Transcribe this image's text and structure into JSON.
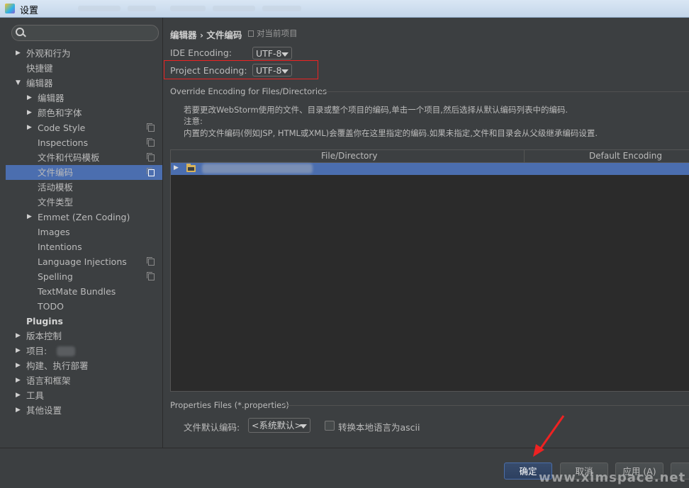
{
  "window": {
    "title": "设置"
  },
  "search": {
    "placeholder": ""
  },
  "sidebar": {
    "items": [
      {
        "label": "外观和行为",
        "arrow": "▶"
      },
      {
        "label": "快捷键"
      },
      {
        "label": "编辑器",
        "arrow": "▼"
      },
      {
        "label": "编辑器",
        "arrow": "▶"
      },
      {
        "label": "颜色和字体",
        "arrow": "▶"
      },
      {
        "label": "Code Style",
        "arrow": "▶"
      },
      {
        "label": "Inspections"
      },
      {
        "label": "文件和代码模板"
      },
      {
        "label": "文件编码"
      },
      {
        "label": "活动模板"
      },
      {
        "label": "文件类型"
      },
      {
        "label": "Emmet (Zen Coding)",
        "arrow": "▶"
      },
      {
        "label": "Images"
      },
      {
        "label": "Intentions"
      },
      {
        "label": "Language Injections"
      },
      {
        "label": "Spelling"
      },
      {
        "label": "TextMate Bundles"
      },
      {
        "label": "TODO"
      },
      {
        "label": "Plugins"
      },
      {
        "label": "版本控制",
        "arrow": "▶"
      },
      {
        "label": "项目:",
        "arrow": "▶"
      },
      {
        "label": "构建、执行部署",
        "arrow": "▶"
      },
      {
        "label": "语言和框架",
        "arrow": "▶"
      },
      {
        "label": "工具",
        "arrow": "▶"
      },
      {
        "label": "其他设置",
        "arrow": "▶"
      }
    ]
  },
  "main": {
    "breadcrumb": "编辑器 › 文件编码",
    "scope_label": "对当前项目",
    "ide_encoding": {
      "label": "IDE Encoding:",
      "value": "UTF-8"
    },
    "project_encoding": {
      "label": "Project Encoding:",
      "value": "UTF-8"
    },
    "override_title": "Override Encoding for Files/Directories",
    "desc1": "若要更改WebStorm使用的文件、目录或整个项目的编码,单击一个项目,然后选择从默认编码列表中的编码.",
    "desc2": "注意:",
    "desc3": "内置的文件编码(例如JSP, HTML或XML)会覆盖你在这里指定的编码.如果未指定,文件和目录会从父级继承编码设置.",
    "table": {
      "col1": "File/Directory",
      "col2": "Default Encoding"
    },
    "properties_title": "Properties Files (*.properties)",
    "default_encoding_label": "文件默认编码:",
    "default_encoding_value": "<系统默认>",
    "native_to_ascii_label": "转换本地语言为ascii"
  },
  "footer": {
    "ok": "确定",
    "cancel": "取消",
    "apply": "应用 (A)"
  },
  "watermark": "www.ximspace.net",
  "colors": {
    "selection": "#4b6eaf",
    "highlight": "#ee2222",
    "background": "#3c3f41"
  }
}
